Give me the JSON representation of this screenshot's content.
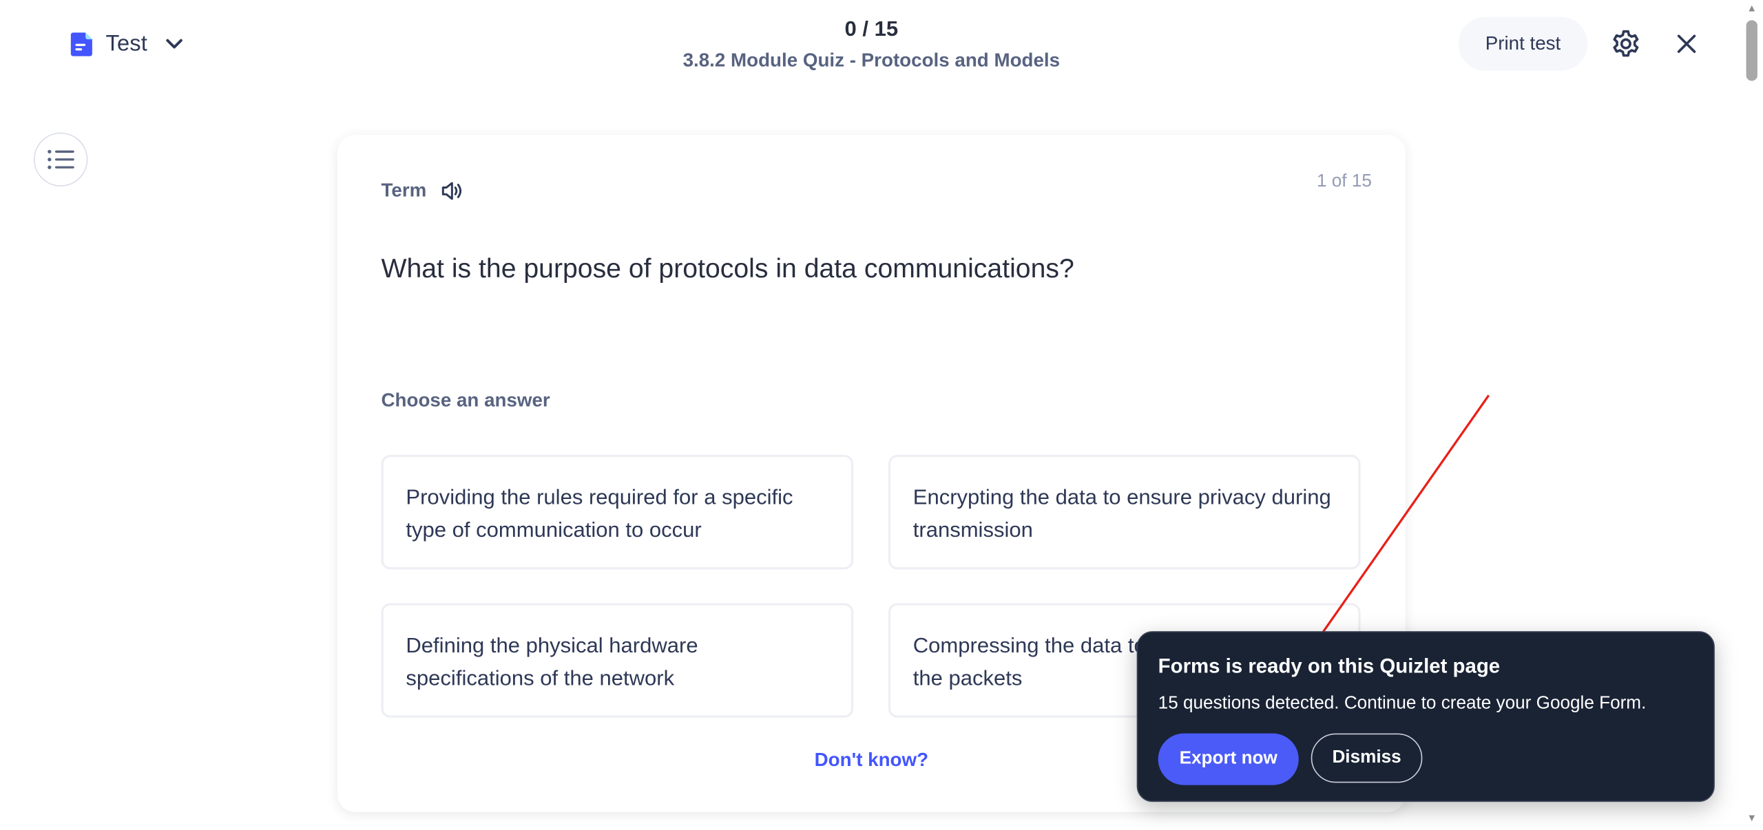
{
  "header": {
    "mode_label": "Test",
    "progress": "0 / 15",
    "set_title": "3.8.2 Module Quiz - Protocols and Models",
    "print_label": "Print test"
  },
  "card": {
    "term_label": "Term",
    "counter": "1 of 15",
    "question": "What is the purpose of protocols in data communications?",
    "choose_label": "Choose an answer",
    "options": [
      "Providing the rules required for a specific type of communication to occur",
      "Encrypting the data to ensure privacy during transmission",
      "Defining the physical hardware specifications of the network",
      "Compressing the data to reduce the size of the packets"
    ],
    "dont_know": "Don't know?"
  },
  "popup": {
    "title": "Forms is ready on this Quizlet page",
    "message": "15 questions detected. Continue to create your Google Form.",
    "export_label": "Export now",
    "dismiss_label": "Dismiss"
  },
  "icons": {
    "mode": "document-icon",
    "chevron": "chevron-down-icon",
    "settings": "gear-icon",
    "close": "close-icon",
    "list": "list-icon",
    "speaker": "speaker-icon",
    "arrow": "arrow-annotation"
  },
  "colors": {
    "accent": "#4255ff",
    "popup_bg": "#1a2334",
    "arrow": "#e8201a"
  }
}
